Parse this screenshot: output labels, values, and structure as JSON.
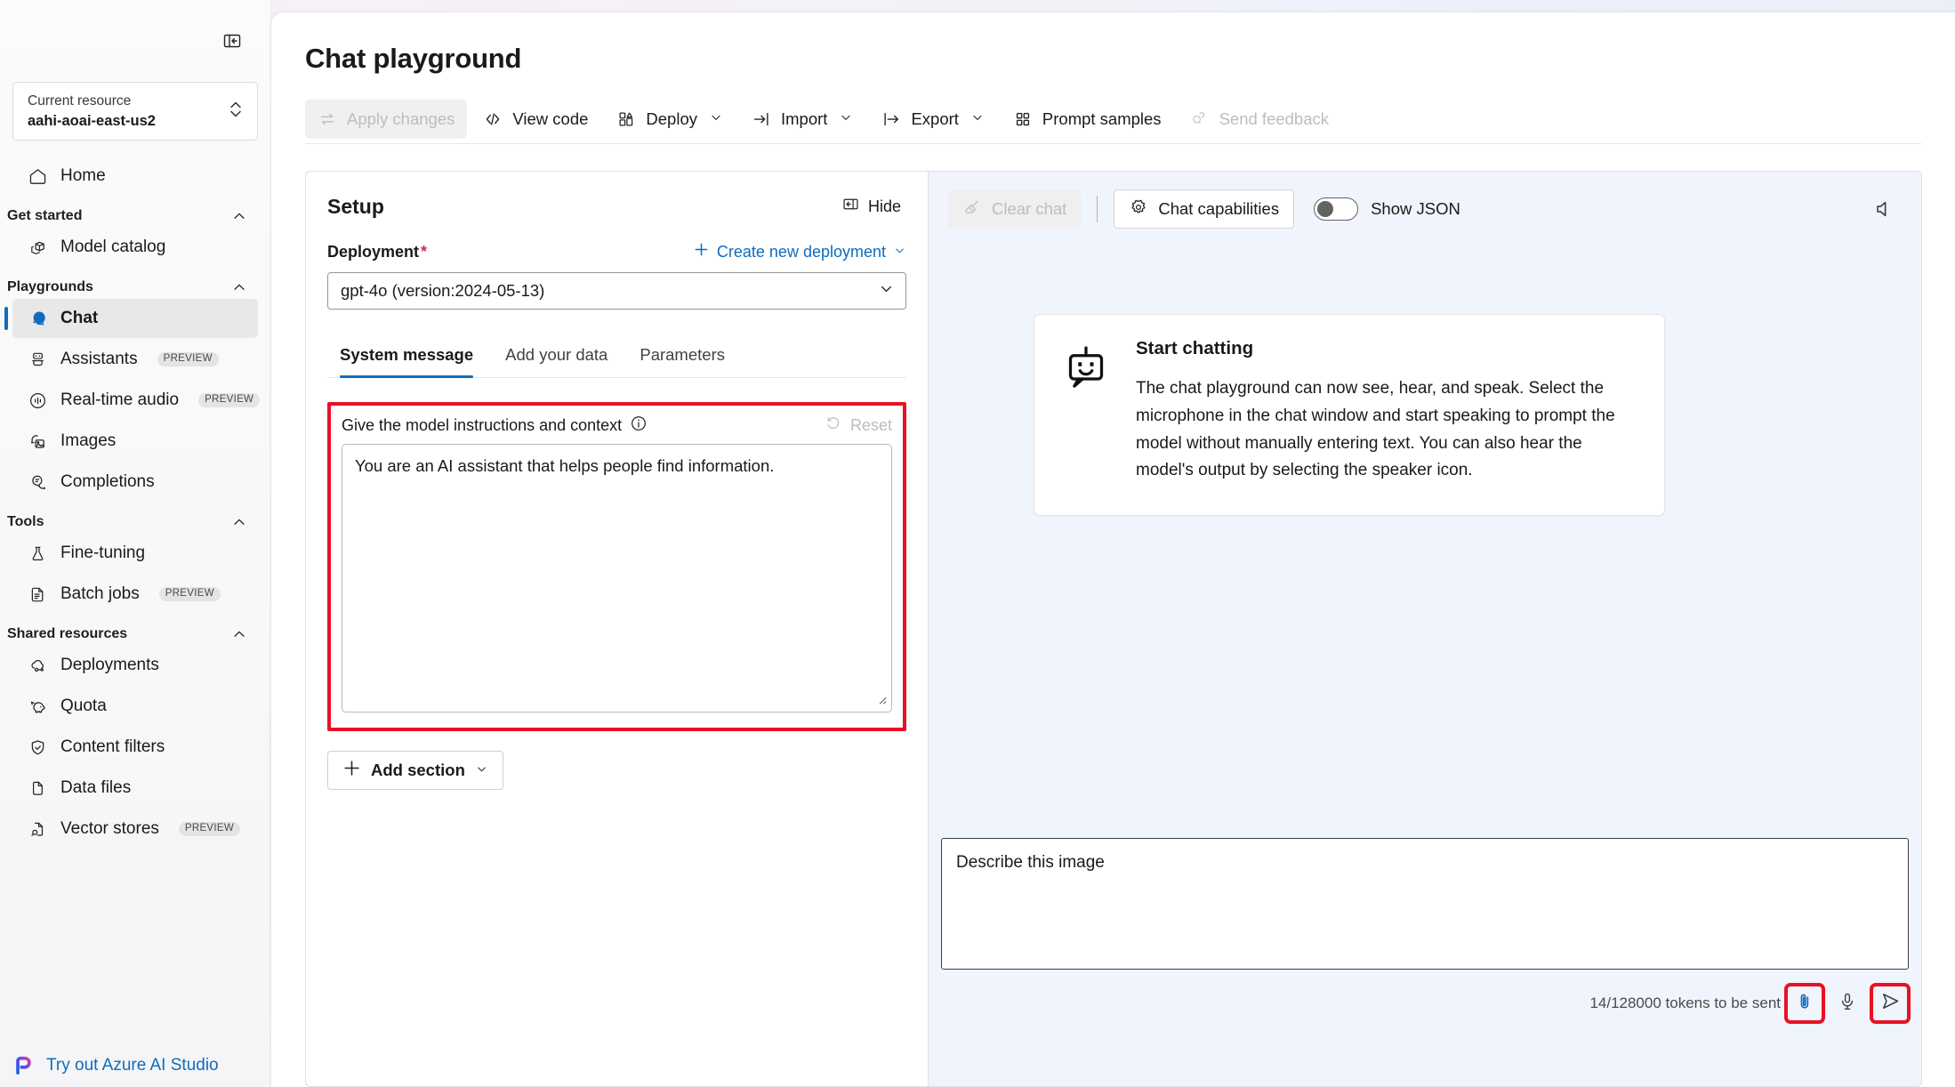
{
  "sidebar": {
    "collapse_icon": "panel-collapse-icon",
    "resource": {
      "label": "Current resource",
      "value": "aahi-aoai-east-us2",
      "chevron_icon": "chevron-updown-icon"
    },
    "home": {
      "label": "Home",
      "icon": "home-icon"
    },
    "groups": [
      {
        "title": "Get started",
        "items": [
          {
            "label": "Model catalog",
            "icon": "model-catalog-icon",
            "badge": ""
          }
        ]
      },
      {
        "title": "Playgrounds",
        "items": [
          {
            "label": "Chat",
            "icon": "chat-icon",
            "badge": "",
            "selected": true
          },
          {
            "label": "Assistants",
            "icon": "assistants-robot-icon",
            "badge": "PREVIEW"
          },
          {
            "label": "Real-time audio",
            "icon": "realtime-audio-icon",
            "badge": "PREVIEW"
          },
          {
            "label": "Images",
            "icon": "images-icon",
            "badge": ""
          },
          {
            "label": "Completions",
            "icon": "completions-icon",
            "badge": ""
          }
        ]
      },
      {
        "title": "Tools",
        "items": [
          {
            "label": "Fine-tuning",
            "icon": "flask-icon",
            "badge": ""
          },
          {
            "label": "Batch jobs",
            "icon": "batch-jobs-icon",
            "badge": "PREVIEW"
          }
        ]
      },
      {
        "title": "Shared resources",
        "items": [
          {
            "label": "Deployments",
            "icon": "deployments-cloud-icon",
            "badge": ""
          },
          {
            "label": "Quota",
            "icon": "piggy-bank-icon",
            "badge": ""
          },
          {
            "label": "Content filters",
            "icon": "shield-check-icon",
            "badge": ""
          },
          {
            "label": "Data files",
            "icon": "documents-icon",
            "badge": ""
          },
          {
            "label": "Vector stores",
            "icon": "vector-store-search-icon",
            "badge": "PREVIEW"
          }
        ]
      }
    ],
    "studio_link": {
      "label": "Try out Azure AI Studio",
      "icon": "azure-ai-studio-logo-icon"
    }
  },
  "header": {
    "title": "Chat playground"
  },
  "toolbar": {
    "apply_changes": {
      "label": "Apply changes",
      "icon": "apply-changes-icon",
      "disabled": true
    },
    "view_code": {
      "label": "View code",
      "icon": "code-brackets-icon"
    },
    "deploy": {
      "label": "Deploy",
      "icon": "deploy-icon",
      "caret": "chevron-down-icon"
    },
    "import": {
      "label": "Import",
      "icon": "import-arrow-icon",
      "caret": "chevron-down-icon"
    },
    "export": {
      "label": "Export",
      "icon": "export-arrow-icon",
      "caret": "chevron-down-icon"
    },
    "prompt_samples": {
      "label": "Prompt samples",
      "icon": "grid-squares-icon"
    },
    "send_feedback": {
      "label": "Send feedback",
      "icon": "feedback-icon",
      "disabled": true
    }
  },
  "setup": {
    "title": "Setup",
    "hide": {
      "label": "Hide",
      "icon": "hide-panel-icon"
    },
    "deployment": {
      "label": "Deployment",
      "required_marker": "*",
      "create_new": {
        "label": "Create new deployment",
        "plus_icon": "plus-icon",
        "caret": "chevron-down-icon"
      },
      "selected_value": "gpt-4o (version:2024-05-13)",
      "chevron_icon": "chevron-down-icon"
    },
    "tabs": [
      {
        "label": "System message",
        "active": true
      },
      {
        "label": "Add your data",
        "active": false
      },
      {
        "label": "Parameters",
        "active": false
      }
    ],
    "system_message": {
      "label": "Give the model instructions and context",
      "info_icon": "info-circle-icon",
      "reset": {
        "label": "Reset",
        "icon": "reset-undo-icon",
        "disabled": true
      },
      "value": "You are an AI assistant that helps people find information.",
      "placeholder": "",
      "highlight_color": "#e81123"
    },
    "add_section": {
      "label": "Add section",
      "plus_icon": "plus-icon",
      "caret": "chevron-down-icon"
    }
  },
  "chat": {
    "clear_chat": {
      "label": "Clear chat",
      "icon": "broom-icon",
      "disabled": true
    },
    "chat_capabilities": {
      "label": "Chat capabilities",
      "icon": "gear-icon"
    },
    "show_json": {
      "label": "Show JSON",
      "toggle_on": false
    },
    "speaker_icon": "speaker-icon",
    "empty_state": {
      "icon": "bot-smile-icon",
      "title": "Start chatting",
      "body": "The chat playground can now see, hear, and speak. Select the microphone in the chat window and start speaking to prompt the model without manually entering text. You can also hear the model's output by selecting the speaker icon."
    },
    "composer": {
      "value": "Describe this image",
      "placeholder": "Type user query here (Shift + Enter for new line)",
      "token_count": "14/128000 tokens to be sent",
      "attach": {
        "icon": "paperclip-icon",
        "highlighted": true
      },
      "mic": {
        "icon": "microphone-icon",
        "highlighted": false
      },
      "send": {
        "icon": "send-icon",
        "highlighted": true
      },
      "highlight_color": "#e81123"
    }
  },
  "colors": {
    "accent": "#0f6cbd",
    "highlight": "#e81123",
    "chat_bg": "#f0f4fc",
    "sidebar_bg": "#f8f8f9"
  }
}
